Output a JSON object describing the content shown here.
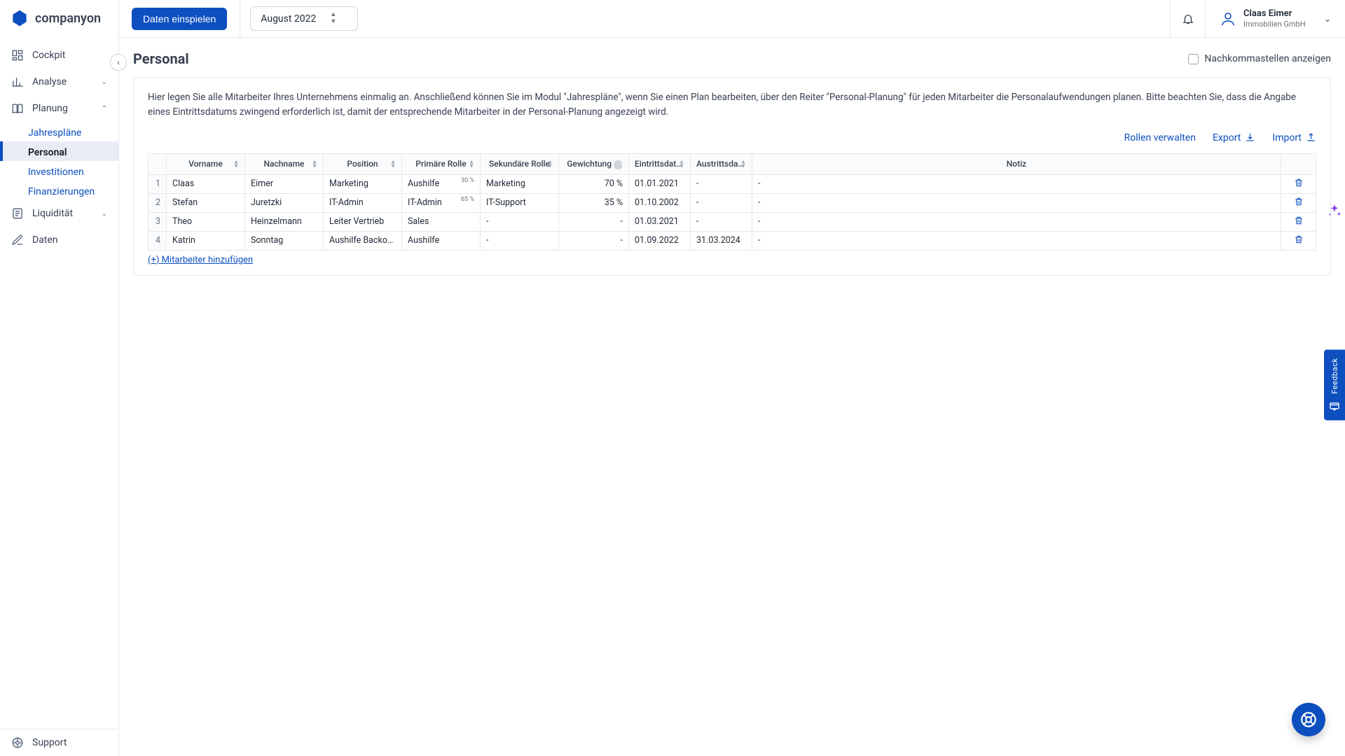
{
  "brand": "companyon",
  "topbar": {
    "import_btn": "Daten einspielen",
    "month": "August 2022",
    "user_name": "Claas Eimer",
    "user_company": "Immobilien GmbH"
  },
  "sidebar": {
    "items": [
      {
        "label": "Cockpit"
      },
      {
        "label": "Analyse",
        "expandable": true
      },
      {
        "label": "Planung",
        "expandable": true,
        "expanded": true,
        "children": [
          {
            "label": "Jahrespläne"
          },
          {
            "label": "Personal",
            "active": true
          },
          {
            "label": "Investitionen"
          },
          {
            "label": "Finanzierungen"
          }
        ]
      },
      {
        "label": "Liquidität",
        "expandable": true
      },
      {
        "label": "Daten"
      }
    ],
    "footer": "Support"
  },
  "page": {
    "title": "Personal",
    "decimals_label": "Nachkommastellen anzeigen",
    "description": "Hier legen Sie alle Mitarbeiter Ihres Unternehmens einmalig an. Anschließend können Sie im Modul \"Jahrespläne\", wenn Sie einen Plan bearbeiten, über den Reiter \"Personal-Planung\" für jeden Mitarbeiter die Personalaufwendungen planen. Bitte beachten Sie, dass die Angabe eines Eintrittsdatums zwingend erforderlich ist, damit der entsprechende Mitarbeiter in der Personal-Planung angezeigt wird.",
    "action_roles": "Rollen verwalten",
    "action_export": "Export",
    "action_import": "Import",
    "add_employee": "(+) Mitarbeiter hinzufügen"
  },
  "table": {
    "headers": {
      "vorname": "Vorname",
      "nachname": "Nachname",
      "position": "Position",
      "prim": "Primäre Rolle",
      "sek": "Sekundäre Rolle",
      "gew": "Gewichtung",
      "ein": "Eintrittsdatum",
      "aus": "Austrittsdat…",
      "notiz": "Notiz"
    },
    "rows": [
      {
        "idx": "1",
        "vorname": "Claas",
        "nachname": "Eimer",
        "position": "Marketing",
        "prim": "Aushilfe",
        "prim_pct": "30 %",
        "sek": "Marketing",
        "gew": "70 %",
        "ein": "01.01.2021",
        "aus": "-",
        "notiz": "-"
      },
      {
        "idx": "2",
        "vorname": "Stefan",
        "nachname": "Juretzki",
        "position": "IT-Admin",
        "prim": "IT-Admin",
        "prim_pct": "65 %",
        "sek": "IT-Support",
        "gew": "35 %",
        "ein": "01.10.2002",
        "aus": "-",
        "notiz": "-"
      },
      {
        "idx": "3",
        "vorname": "Theo",
        "nachname": "Heinzelmann",
        "position": "Leiter Vertrieb",
        "prim": "Sales",
        "prim_pct": "",
        "sek": "-",
        "gew": "-",
        "ein": "01.03.2021",
        "aus": "-",
        "notiz": "-"
      },
      {
        "idx": "4",
        "vorname": "Katrin",
        "nachname": "Sonntag",
        "position": "Aushilfe Backoffice",
        "prim": "Aushilfe",
        "prim_pct": "",
        "sek": "-",
        "gew": "-",
        "ein": "01.09.2022",
        "aus": "31.03.2024",
        "notiz": "-"
      }
    ]
  },
  "feedback_label": "Feedback"
}
